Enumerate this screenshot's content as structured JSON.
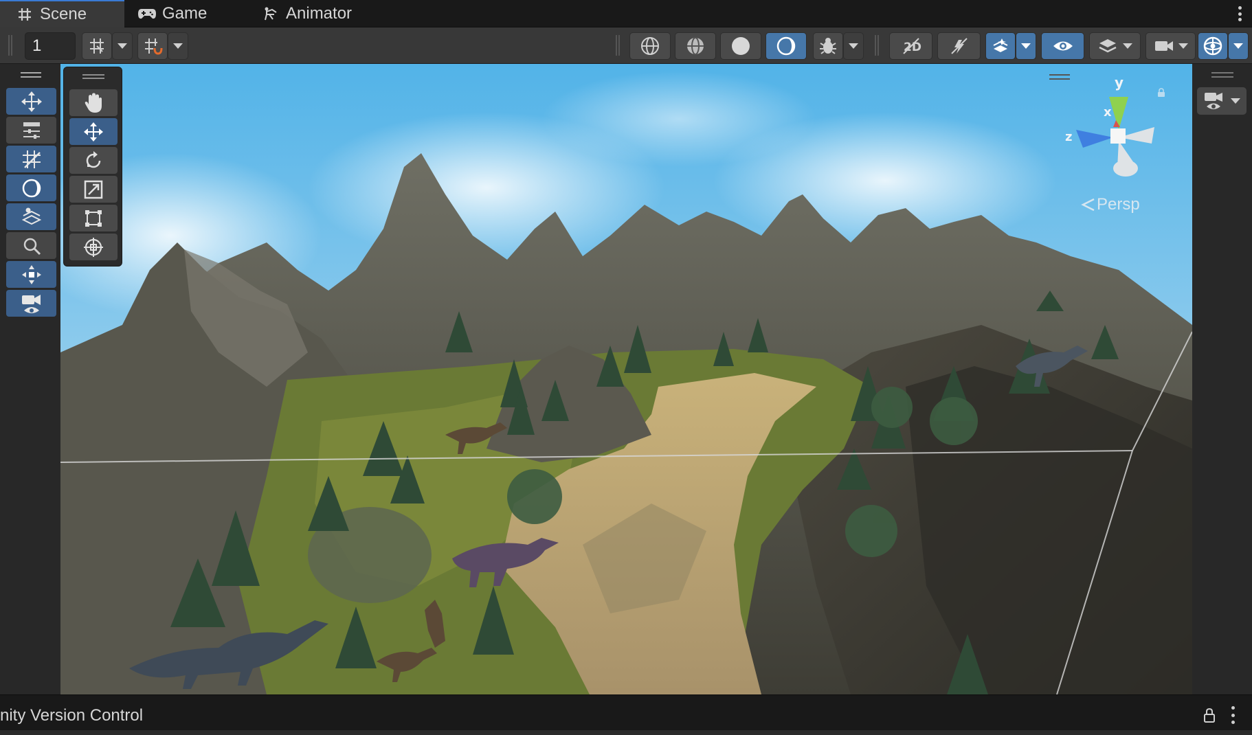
{
  "tabs": [
    {
      "label": "Scene",
      "icon": "grid-hash-icon",
      "active": true
    },
    {
      "label": "Game",
      "icon": "gamepad-icon",
      "active": false
    },
    {
      "label": "Animator",
      "icon": "animator-icon",
      "active": false
    }
  ],
  "toolbar": {
    "grid_value": "1",
    "buttons": [
      "grid-snap-toggle",
      "grid-snap-dropdown",
      "increment-snap-toggle",
      "increment-snap-dropdown",
      "wireframe-shading",
      "shaded-wireframe",
      "shaded",
      "unlit-shading-active",
      "debug-draw-mode",
      "debug-draw-dropdown",
      "2d-toggle",
      "lighting-toggle",
      "audio-fx-toggle",
      "fx-dropdown",
      "scene-visibility",
      "layers-dropdown",
      "camera-dropdown",
      "gizmos-toggle",
      "gizmos-dropdown"
    ]
  },
  "left_overlay": {
    "items": [
      "transform-tools",
      "tool-settings",
      "grid-and-snap",
      "view-options",
      "search-overlay",
      "orientation",
      "camera-overlay"
    ]
  },
  "tool_palette": {
    "items": [
      "hand-tool",
      "move-tool",
      "rotate-tool",
      "scale-tool",
      "rect-tool",
      "transform-tool"
    ],
    "active": "move-tool"
  },
  "gizmo": {
    "y_label": "y",
    "x_label": "x",
    "z_label": "z",
    "projection_label": "Persp"
  },
  "statusbar": {
    "text": "nity Version Control"
  },
  "colors": {
    "accent": "#3b5f8a",
    "sky": "#6fbde6",
    "gizmo_y": "#8fd14f",
    "gizmo_z": "#3f7fe0"
  }
}
